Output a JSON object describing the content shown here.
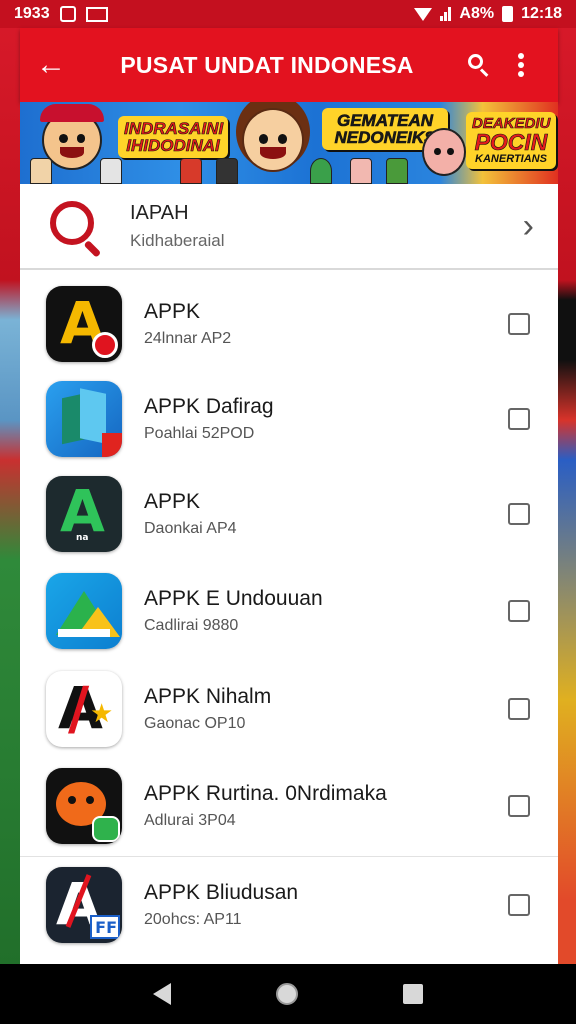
{
  "status_bar": {
    "left_text": "1933",
    "battery": "A8%",
    "time": "12:18"
  },
  "app_bar": {
    "title": "PUSAT UNDAT INDONESA"
  },
  "banner": {
    "text_left": "INDRASAINI IHIDODINAI",
    "text_mid": "GEMATEAN NEDONEIKS",
    "text_right_top": "DEAKEDIU",
    "text_right_big": "POCIN",
    "text_right_small": "KANERTIANS"
  },
  "header": {
    "title": "IAPAH",
    "subtitle": "Kidhaberaial"
  },
  "apps": [
    {
      "name": "APPK",
      "sub": "24lnnar AP2",
      "icon": "letter-a-black-icon"
    },
    {
      "name": "APPK Dafirag",
      "sub": "Poahlai 52POD",
      "icon": "blue-folder-icon"
    },
    {
      "name": "APPK",
      "sub": "Daonkai AP4",
      "icon": "green-a-dark-icon"
    },
    {
      "name": "APPK E Undouuan",
      "sub": "Cadlirai 9880",
      "icon": "drive-triangle-icon"
    },
    {
      "name": "APPK Nihalm",
      "sub": "Gaonac OP10",
      "icon": "red-a-star-icon"
    },
    {
      "name": "APPK Rurtina. 0Nrdimaka",
      "sub": "Adlurai 3P04",
      "icon": "orange-mascot-icon"
    },
    {
      "name": "APPK Bliudusan",
      "sub": "20ohcs: AP11",
      "icon": "ff-a-icon"
    }
  ],
  "colors": {
    "primary": "#e3121f",
    "status": "#c4101f",
    "accent": "#c41320"
  }
}
